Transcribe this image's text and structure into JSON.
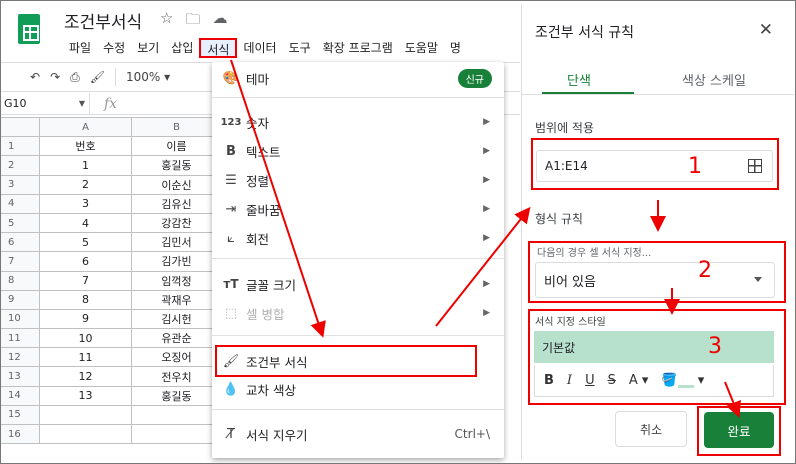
{
  "app": {
    "doc_title": "조건부서식",
    "title_icons": [
      "star-icon",
      "folder-move-icon",
      "cloud-icon"
    ],
    "menus": [
      "파일",
      "수정",
      "보기",
      "삽입",
      "서식",
      "데이터",
      "도구",
      "확장 프로그램",
      "도움말",
      "명"
    ],
    "active_menu": "서식"
  },
  "toolbar": {
    "zoom": "100%"
  },
  "formula_bar": {
    "name_box": "G10",
    "fx": "fx"
  },
  "sheet": {
    "columns": [
      "A",
      "B"
    ],
    "rows": [
      {
        "n": "1",
        "a": "번호",
        "b": "이름"
      },
      {
        "n": "2",
        "a": "1",
        "b": "홍길동"
      },
      {
        "n": "3",
        "a": "2",
        "b": "이순신"
      },
      {
        "n": "4",
        "a": "3",
        "b": "김유신"
      },
      {
        "n": "5",
        "a": "4",
        "b": "강감찬"
      },
      {
        "n": "6",
        "a": "5",
        "b": "김민서"
      },
      {
        "n": "7",
        "a": "6",
        "b": "김가빈"
      },
      {
        "n": "8",
        "a": "7",
        "b": "임꺽정"
      },
      {
        "n": "9",
        "a": "8",
        "b": "곽재우"
      },
      {
        "n": "10",
        "a": "9",
        "b": "김시헌"
      },
      {
        "n": "11",
        "a": "10",
        "b": "유관순"
      },
      {
        "n": "12",
        "a": "11",
        "b": "오징어"
      },
      {
        "n": "13",
        "a": "12",
        "b": "전우치"
      },
      {
        "n": "14",
        "a": "13",
        "b": "홍길동"
      },
      {
        "n": "15",
        "a": "",
        "b": ""
      },
      {
        "n": "16",
        "a": "",
        "b": ""
      }
    ]
  },
  "format_menu": {
    "theme": "테마",
    "new_badge": "신규",
    "number_icon": "123",
    "number": "숫자",
    "text": "텍스트",
    "align": "정렬",
    "wrap": "줄바꿈",
    "rotate": "회전",
    "font_size": "글꼴 크기",
    "merge": "셀 병합",
    "conditional": "조건부 서식",
    "alternating": "교차 색상",
    "clear": "서식 지우기",
    "clear_shortcut": "Ctrl+\\"
  },
  "panel": {
    "title": "조건부 서식 규칙",
    "tab_single": "단색",
    "tab_scale": "색상 스케일",
    "range_label": "범위에 적용",
    "range_value": "A1:E14",
    "rules_label": "형식 규칙",
    "condition_caption": "다음의 경우 셀 서식 지정...",
    "condition_value": "비어 있음",
    "style_caption": "서식 지정 스타일",
    "style_preview": "기본값",
    "style_tools": [
      "B",
      "I",
      "U",
      "S",
      "A"
    ],
    "cancel": "취소",
    "done": "완료",
    "preview_color": "#b7e1cd",
    "accent_color": "#188038"
  },
  "annotations": {
    "step1": "1",
    "step2": "2",
    "step3": "3",
    "highlight_color": "#ee0000"
  }
}
